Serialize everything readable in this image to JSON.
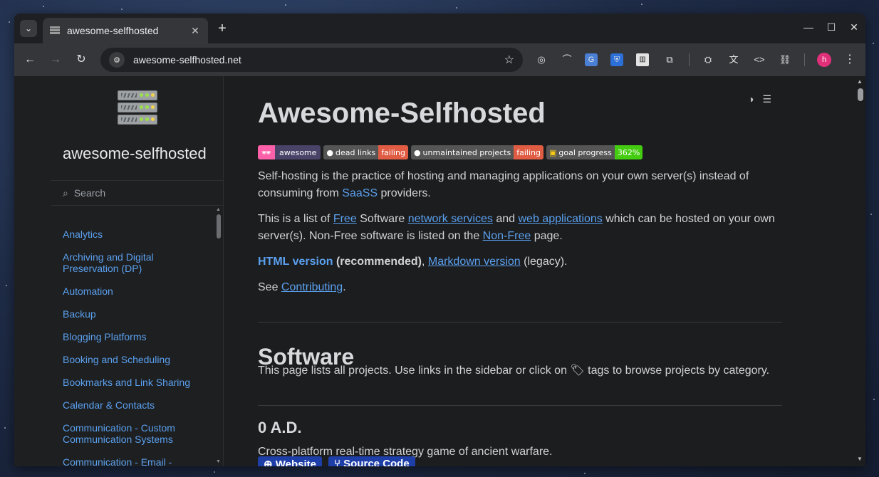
{
  "browser": {
    "tab_title": "awesome-selfhosted",
    "url": "awesome-selfhosted.net",
    "profile_initial": "h"
  },
  "sidebar": {
    "site_name": "awesome-selfhosted",
    "search_placeholder": "Search",
    "categories": [
      "Analytics",
      "Archiving and Digital Preservation (DP)",
      "Automation",
      "Backup",
      "Blogging Platforms",
      "Booking and Scheduling",
      "Bookmarks and Link Sharing",
      "Calendar & Contacts",
      "Communication - Custom Communication Systems",
      "Communication - Email -"
    ]
  },
  "main": {
    "title": "Awesome-Selfhosted",
    "badges": {
      "awesome": "awesome",
      "dead_links_label": "dead links",
      "dead_links_status": "failing",
      "unmaintained_label": "unmaintained projects",
      "unmaintained_status": "failing",
      "goal_label": "goal progress",
      "goal_value": "362%"
    },
    "intro": {
      "p1_a": "Self-hosting is the practice of hosting and managing applications on your own server(s) instead of consuming from ",
      "p1_link": "SaaSS",
      "p1_b": " providers.",
      "p2_a": "This is a list of ",
      "p2_link1": "Free",
      "p2_b": " Software ",
      "p2_link2": "network services",
      "p2_c": " and ",
      "p2_link3": "web applications",
      "p2_d": " which can be hosted on your own server(s). Non-Free software is listed on the ",
      "p2_link4": "Non-Free",
      "p2_e": " page.",
      "p3_link1": "HTML version",
      "p3_bold": " (recommended)",
      "p3_a": ", ",
      "p3_link2": "Markdown version",
      "p3_b": " (legacy).",
      "p4_a": "See ",
      "p4_link": "Contributing",
      "p4_b": "."
    },
    "software_heading": "Software",
    "software_desc_a": "This page lists all projects. Use links in the sidebar or click on ",
    "software_desc_b": " tags to browse projects by category.",
    "project": {
      "name": "0 A.D.",
      "description": "Cross-platform real-time strategy game of ancient warfare.",
      "website_label": "Website",
      "source_label": "Source Code"
    }
  },
  "colors": {
    "link": "#5aa0ee",
    "badge_failing": "#e05d44",
    "badge_goal": "#44cc11",
    "project_button": "#1f3fa8",
    "profile": "#e0307a"
  }
}
